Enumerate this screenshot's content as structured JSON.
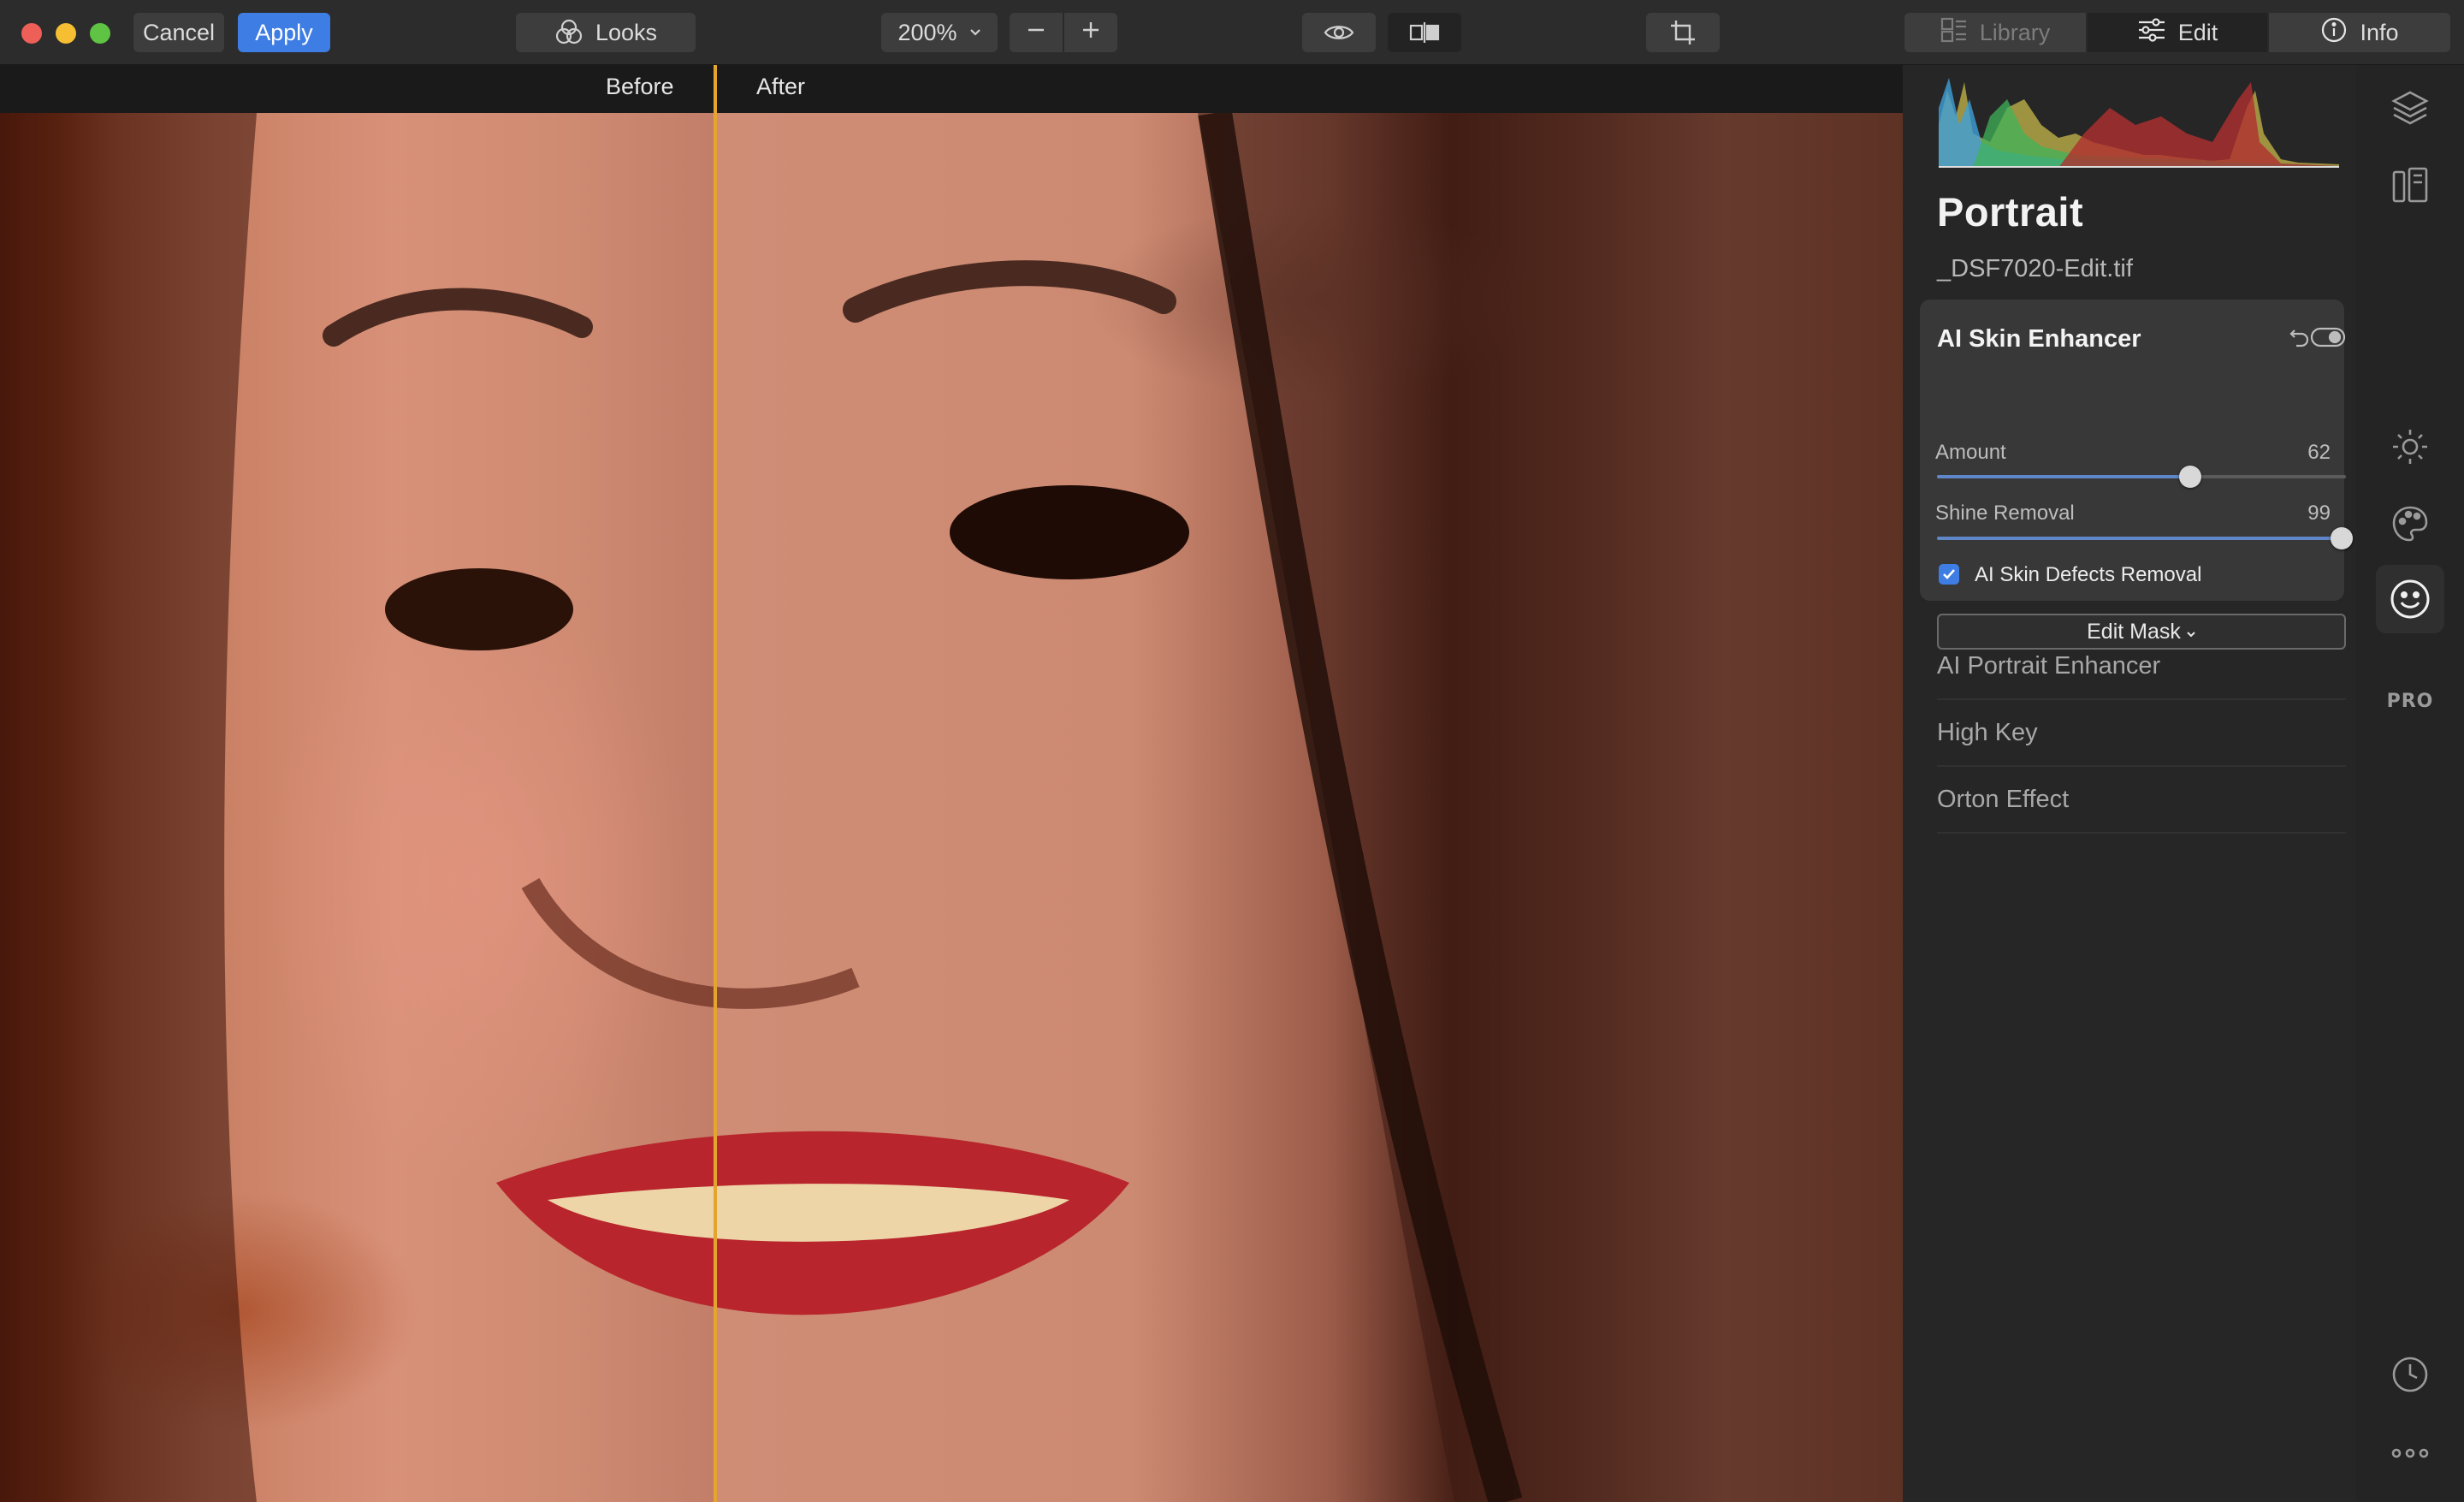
{
  "toolbar": {
    "cancel_label": "Cancel",
    "apply_label": "Apply",
    "looks_label": "Looks",
    "zoom_value": "200%",
    "tabs": [
      {
        "label": "Library",
        "icon": "library-icon"
      },
      {
        "label": "Edit",
        "icon": "sliders-icon"
      },
      {
        "label": "Info",
        "icon": "info-icon"
      }
    ]
  },
  "canvas": {
    "before_label": "Before",
    "after_label": "After"
  },
  "sidebar": {
    "title": "Portrait",
    "filename": "_DSF7020-Edit.tif",
    "panel": {
      "title": "AI Skin Enhancer",
      "sliders": [
        {
          "label": "Amount",
          "value": "62",
          "fraction": 0.62
        },
        {
          "label": "Shine Removal",
          "value": "99",
          "fraction": 0.99
        }
      ],
      "checkbox_label": "AI Skin Defects Removal",
      "checkbox_checked": true,
      "edit_mask_label": "Edit Mask"
    },
    "tools": [
      {
        "label": "AI Portrait Enhancer"
      },
      {
        "label": "High Key"
      },
      {
        "label": "Orton Effect"
      }
    ]
  },
  "rail": {
    "pro_label": "PRO"
  },
  "colors": {
    "accent": "#3e7de3",
    "divider": "#e3a52e",
    "background": "#1e1e1e"
  }
}
